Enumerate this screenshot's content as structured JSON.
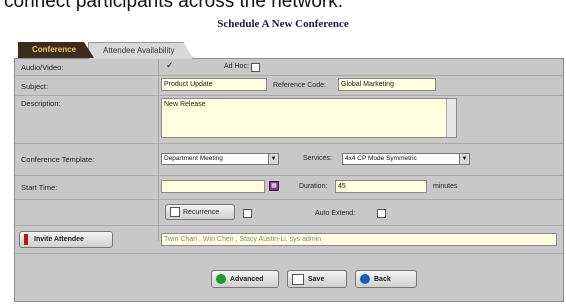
{
  "caption": "connect participants across the network.",
  "page_title": "Schedule A New Conference",
  "tabs": [
    "Conference",
    "Attendee Availability"
  ],
  "form": {
    "audio_video_label": "Audio/Video:",
    "ad_hoc_label": "Ad Hoc:",
    "subject_label": "Subject:",
    "subject_value": "Product Update",
    "reference_code_label": "Reference Code:",
    "reference_code_value": "Global Marketing",
    "description_label": "Description:",
    "description_value": "New Release",
    "template_label": "Conference Template:",
    "template_value": "Department Meeting",
    "services_label": "Services:",
    "services_value": "4x4 CP Mode Symmetric",
    "start_time_label": "Start Time:",
    "start_time_value": "",
    "duration_label": "Duration:",
    "duration_value": "45",
    "minutes_label": "minutes",
    "recurrence_label": "Recurrence",
    "auto_extend_label": "Auto Extend:",
    "invite_label": "Invite Attendee",
    "attendees_value": "Twin Chan , Win Chen , Stacy Austin-Li, sys admin"
  },
  "buttons": {
    "advanced": "Advanced",
    "save": "Save",
    "back": "Back"
  },
  "colors": {
    "panel": "#c8c8c8",
    "field": "#ffffe0",
    "tab_active": "#3a2d1c",
    "tab_active_text": "#f4c56b"
  }
}
